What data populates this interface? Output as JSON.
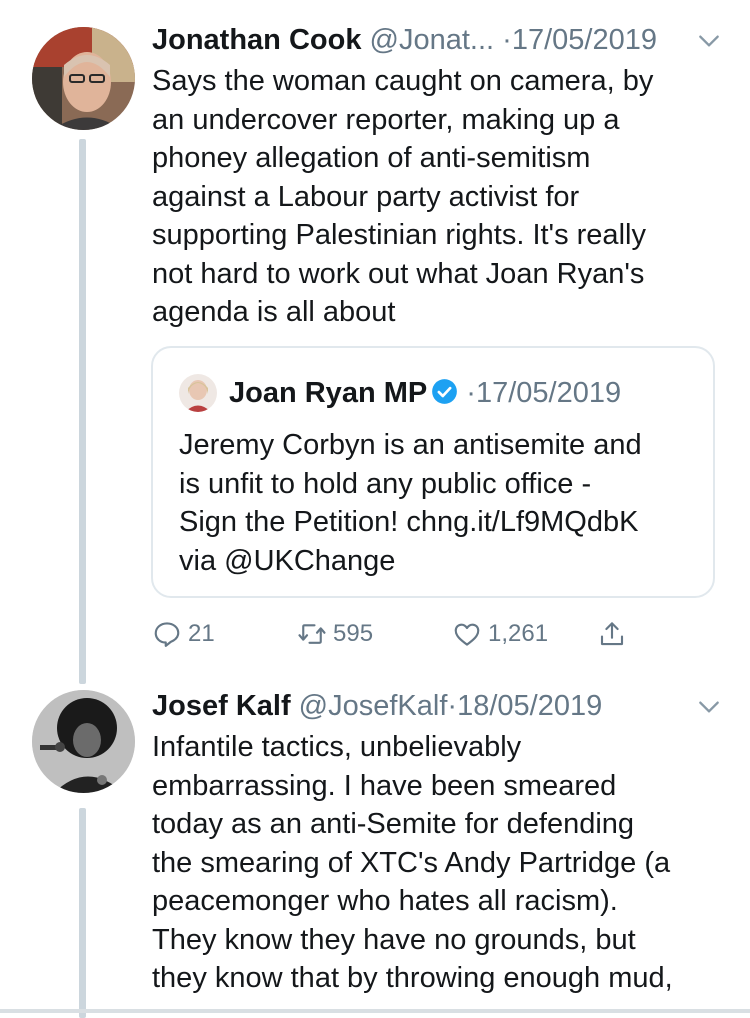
{
  "tweets": [
    {
      "name": "Jonathan Cook",
      "handle": "@Jonat...",
      "dot": "·",
      "date": "17/05/2019",
      "lines": [
        "Says the woman caught on camera, by",
        "an undercover reporter, making up a",
        "phoney allegation of anti-semitism",
        "against a Labour party activist for",
        "supporting Palestinian rights. It's really",
        "not hard to work out what Joan Ryan's",
        "agenda is all about"
      ],
      "quoted": {
        "name": "Joan Ryan MP",
        "dot": "·",
        "date": "17/05/2019",
        "lines": [
          "Jeremy Corbyn is an antisemite and",
          "is unfit to hold any public office -",
          "Sign the Petition! chng.it/Lf9MQdbK",
          "via @UKChange"
        ]
      },
      "actions": {
        "replies": "21",
        "retweets": "595",
        "likes": "1,261"
      }
    },
    {
      "name": "Josef Kalf",
      "handle": "@JosefKalf",
      "dot": "·",
      "date": "18/05/2019",
      "lines": [
        "Infantile tactics, unbelievably",
        "embarrassing. I have been smeared",
        "today as an anti-Semite for defending",
        "the smearing of XTC's Andy Partridge (a",
        "peacemonger who hates all racism).",
        "They know they have no grounds, but",
        "they know that by throwing enough mud,"
      ]
    }
  ],
  "colors": {
    "text": "#14171a",
    "secondary": "#657786",
    "verified": "#1da1f2",
    "thread_line": "#ccd6dd",
    "quote_border": "#e1e8ed"
  },
  "icons": [
    "chevron-down-icon",
    "verified-badge-icon",
    "reply-icon",
    "retweet-icon",
    "like-icon",
    "share-icon"
  ]
}
